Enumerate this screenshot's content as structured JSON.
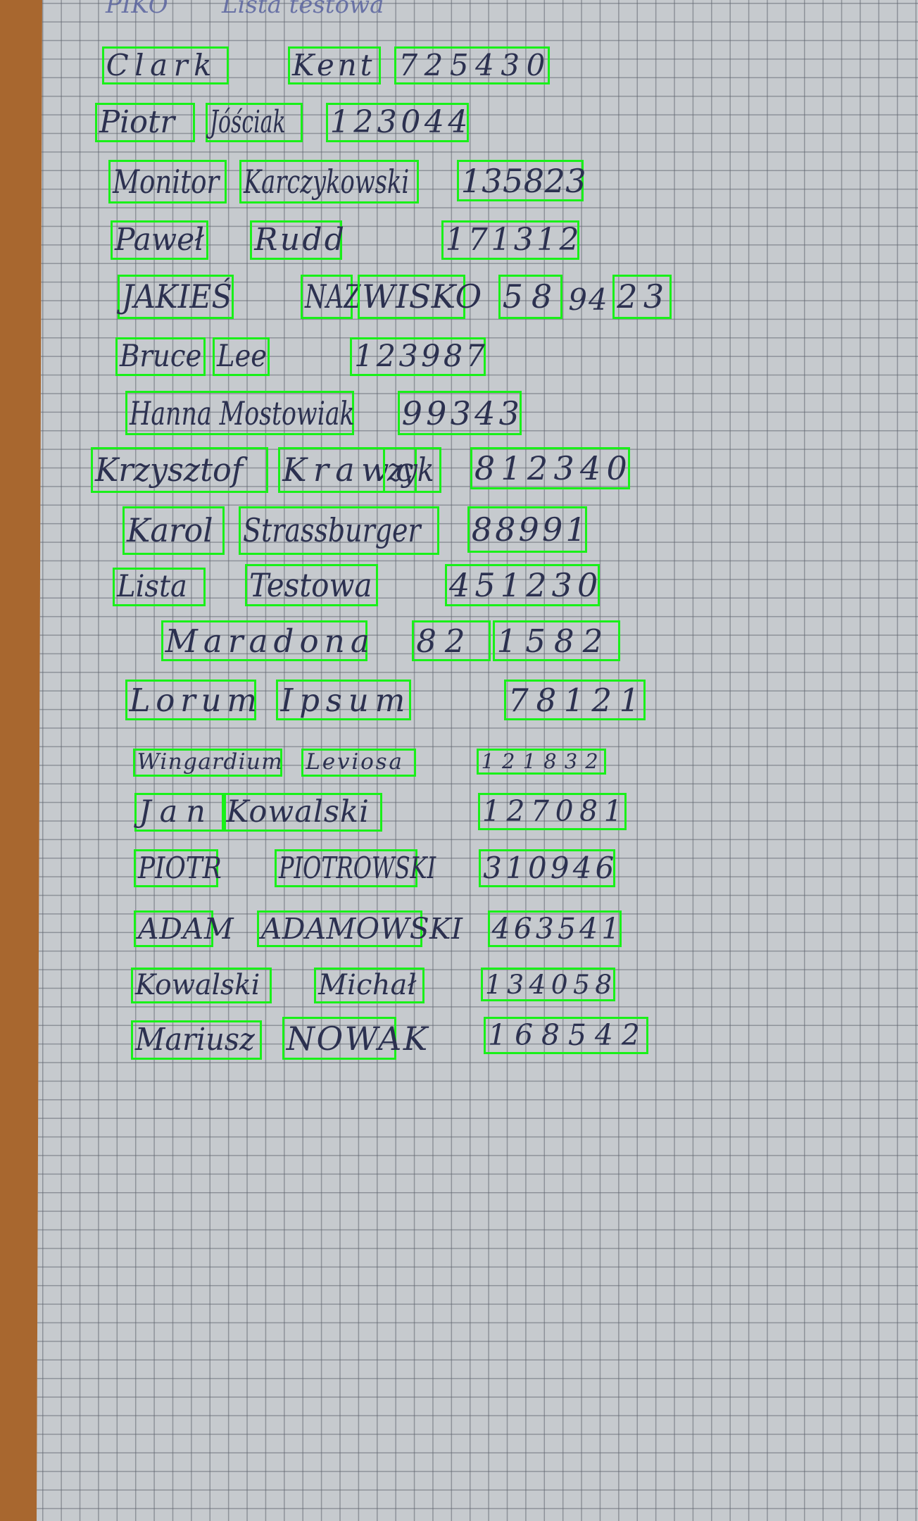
{
  "header": {
    "title_left": "PIKO",
    "title_right": "Lista testowa"
  },
  "box_color": "#19f019",
  "rows": [
    {
      "words": [
        "Clark",
        "Kent",
        "725430"
      ]
    },
    {
      "words": [
        "Piotr",
        "Jóściak",
        "123044"
      ]
    },
    {
      "words": [
        "Monitor",
        "Karczykowski",
        "135823"
      ]
    },
    {
      "words": [
        "Paweł",
        "Rudd",
        "171312"
      ]
    },
    {
      "words": [
        "JAKIEŚ",
        "NAZ",
        "WISKO",
        "58",
        "94",
        "23"
      ]
    },
    {
      "words": [
        "Bruce",
        "Lee",
        "123987"
      ]
    },
    {
      "words": [
        "Hanna Mostowiak",
        "99343"
      ]
    },
    {
      "words": [
        "Krzysztof",
        "Krawc",
        "zyk",
        "812340"
      ]
    },
    {
      "words": [
        "Karol",
        "Strassburger",
        "88991"
      ]
    },
    {
      "words": [
        "Lista",
        "Testowa",
        "451230"
      ]
    },
    {
      "words": [
        "Maradona",
        "82",
        "1582"
      ]
    },
    {
      "words": [
        "Lorum",
        "Ipsum",
        "78121"
      ]
    },
    {
      "words": [
        "Wingardium",
        "Leviosa",
        "121832"
      ]
    },
    {
      "words": [
        "Jan",
        "Kowalski",
        "127081"
      ]
    },
    {
      "words": [
        "PIOTR",
        "PIOTROWSKI",
        "310946"
      ]
    },
    {
      "words": [
        "ADAM",
        "ADAMOWSKI",
        "463541"
      ]
    },
    {
      "words": [
        "Kowalski",
        "Michał",
        "134058"
      ]
    },
    {
      "words": [
        "Mariusz",
        "NOWAK",
        "168542"
      ]
    }
  ]
}
